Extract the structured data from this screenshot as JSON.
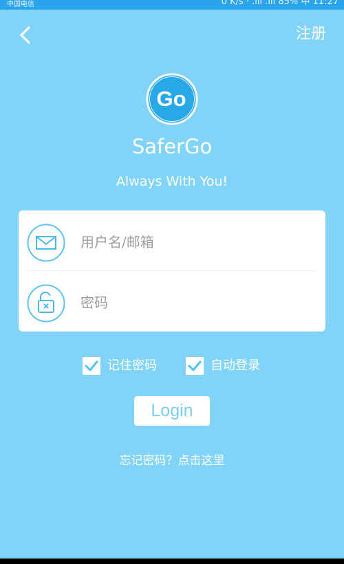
{
  "status_bar": {
    "carrier": "中国电信",
    "right_text": "0 K/s  ·  .ıll  .ıll 85%  中  11:27"
  },
  "header": {
    "register_label": "注册"
  },
  "brand": {
    "logo_text": "Go",
    "app_name": "SaferGo",
    "tagline": "Always With You!"
  },
  "form": {
    "username_placeholder": "用户名/邮箱",
    "password_placeholder": "密码",
    "remember_label": "记住密码",
    "auto_login_label": "自动登录",
    "login_label": "Login",
    "forgot_label": "忘记密码？点击这里"
  },
  "colors": {
    "background": "#81d4f8",
    "status_bar": "#2aa4ec",
    "accent": "#4fc3f7"
  },
  "icons": {
    "back": "chevron-left-icon",
    "username": "mail-icon",
    "password": "unlock-icon",
    "checkbox": "checkmark-icon"
  }
}
